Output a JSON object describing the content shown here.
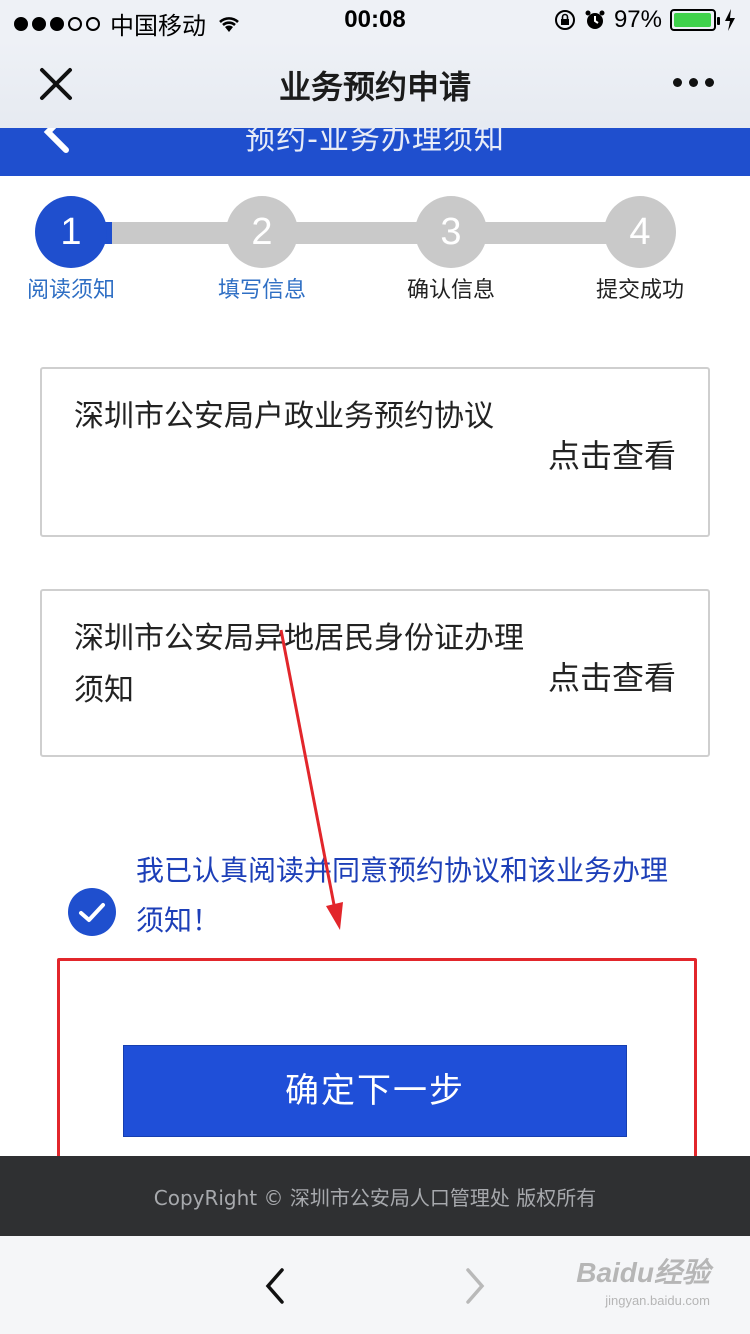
{
  "status_bar": {
    "carrier": "中国移动",
    "time": "00:08",
    "battery_percent": "97%",
    "battery_level": 0.97
  },
  "nav": {
    "title": "业务预约申请"
  },
  "sub_header": {
    "title": "预约-业务办理须知"
  },
  "steps": [
    {
      "number": "1",
      "label": "阅读须知",
      "state": "active"
    },
    {
      "number": "2",
      "label": "填写信息",
      "state": "pending"
    },
    {
      "number": "3",
      "label": "确认信息",
      "state": "pending"
    },
    {
      "number": "4",
      "label": "提交成功",
      "state": "pending"
    }
  ],
  "documents": [
    {
      "title": "深圳市公安局户政业务预约协议",
      "action": "点击查看"
    },
    {
      "title": "深圳市公安局异地居民身份证办理须知",
      "action": "点击查看"
    }
  ],
  "consent": {
    "text": "我已认真阅读并同意预约协议和该业务办理须知！",
    "checked": true
  },
  "primary_button": {
    "label": "确定下一步"
  },
  "footer": {
    "copyright": "CopyRight © 深圳市公安局人口管理处 版权所有"
  },
  "watermark": {
    "main": "Baidu经验",
    "sub": "jingyan.baidu.com"
  },
  "colors": {
    "brand_blue": "#1f4fce",
    "step_inactive": "#c9c9c9",
    "annotation_red": "#e2262b",
    "footer_bg": "#2f3032"
  }
}
